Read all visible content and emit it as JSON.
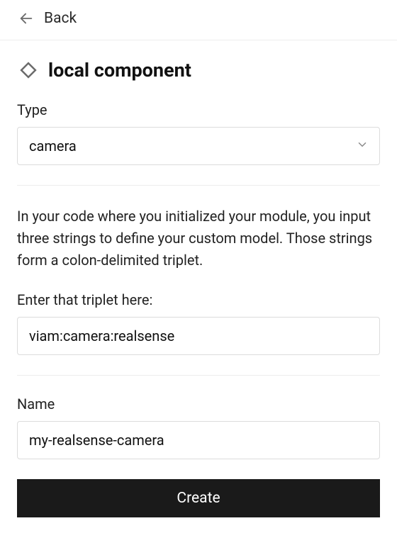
{
  "topbar": {
    "back_label": "Back"
  },
  "header": {
    "title": "local component"
  },
  "type_field": {
    "label": "Type",
    "value": "camera"
  },
  "description": "In your code where you initialized your module, you input three strings to define your custom model. Those strings form a colon-delimited triplet.",
  "triplet_field": {
    "prompt": "Enter that triplet here:",
    "value": "viam:camera:realsense"
  },
  "name_field": {
    "label": "Name",
    "value": "my-realsense-camera"
  },
  "create_button": {
    "label": "Create"
  }
}
